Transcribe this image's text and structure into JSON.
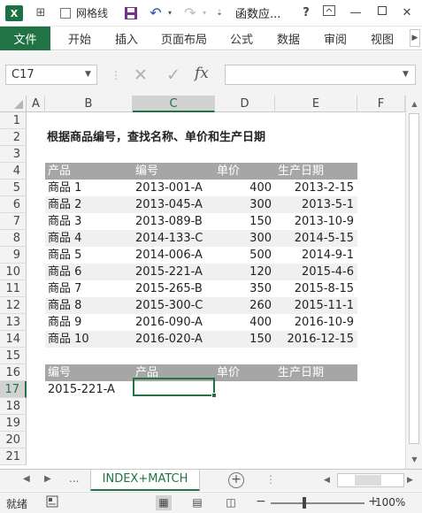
{
  "titlebar": {
    "app_logo": "X",
    "gridlines_label": "网格线",
    "doc_title": "函数应...",
    "help": "?",
    "quick_access_icons": [
      "save-icon",
      "undo-icon",
      "redo-icon",
      "customize-icon"
    ],
    "window_controls": [
      "ribbon-display-icon",
      "minimize-icon",
      "restore-icon",
      "close-icon"
    ]
  },
  "ribbon": {
    "file_tab": "文件",
    "tabs": [
      "开始",
      "插入",
      "页面布局",
      "公式",
      "数据",
      "审阅",
      "视图"
    ]
  },
  "formula_bar": {
    "name_box": "C17",
    "fx": "fx",
    "formula": ""
  },
  "columns": [
    "A",
    "B",
    "C",
    "D",
    "E",
    "F"
  ],
  "selected_column": "C",
  "rows": [
    "1",
    "2",
    "3",
    "4",
    "5",
    "6",
    "7",
    "8",
    "9",
    "10",
    "11",
    "12",
    "13",
    "14",
    "15",
    "16",
    "17",
    "18",
    "19",
    "20",
    "21"
  ],
  "selected_row": "17",
  "sheet": {
    "title": "根据商品编号，查找名称、单价和生产日期",
    "table_header": [
      "产品",
      "编号",
      "单价",
      "生产日期"
    ],
    "table_rows": [
      [
        "商品 1",
        "2013-001-A",
        "400",
        "2013-2-15"
      ],
      [
        "商品 2",
        "2013-045-A",
        "300",
        "2013-5-1"
      ],
      [
        "商品 3",
        "2013-089-B",
        "150",
        "2013-10-9"
      ],
      [
        "商品 4",
        "2014-133-C",
        "300",
        "2014-5-15"
      ],
      [
        "商品 5",
        "2014-006-A",
        "500",
        "2014-9-1"
      ],
      [
        "商品 6",
        "2015-221-A",
        "120",
        "2015-4-6"
      ],
      [
        "商品 7",
        "2015-265-B",
        "350",
        "2015-8-15"
      ],
      [
        "商品 8",
        "2015-300-C",
        "260",
        "2015-11-1"
      ],
      [
        "商品 9",
        "2016-090-A",
        "400",
        "2016-10-9"
      ],
      [
        "商品 10",
        "2016-020-A",
        "150",
        "2016-12-15"
      ]
    ],
    "lookup_header": [
      "编号",
      "产品",
      "单价",
      "生产日期"
    ],
    "lookup_row": [
      "2015-221-A",
      "",
      "",
      ""
    ]
  },
  "tabs_bar": {
    "ellipsis": "...",
    "sheet_tab": "INDEX+MATCH",
    "add_sheet": "+"
  },
  "status": {
    "ready": "就绪",
    "zoom": "100%"
  }
}
